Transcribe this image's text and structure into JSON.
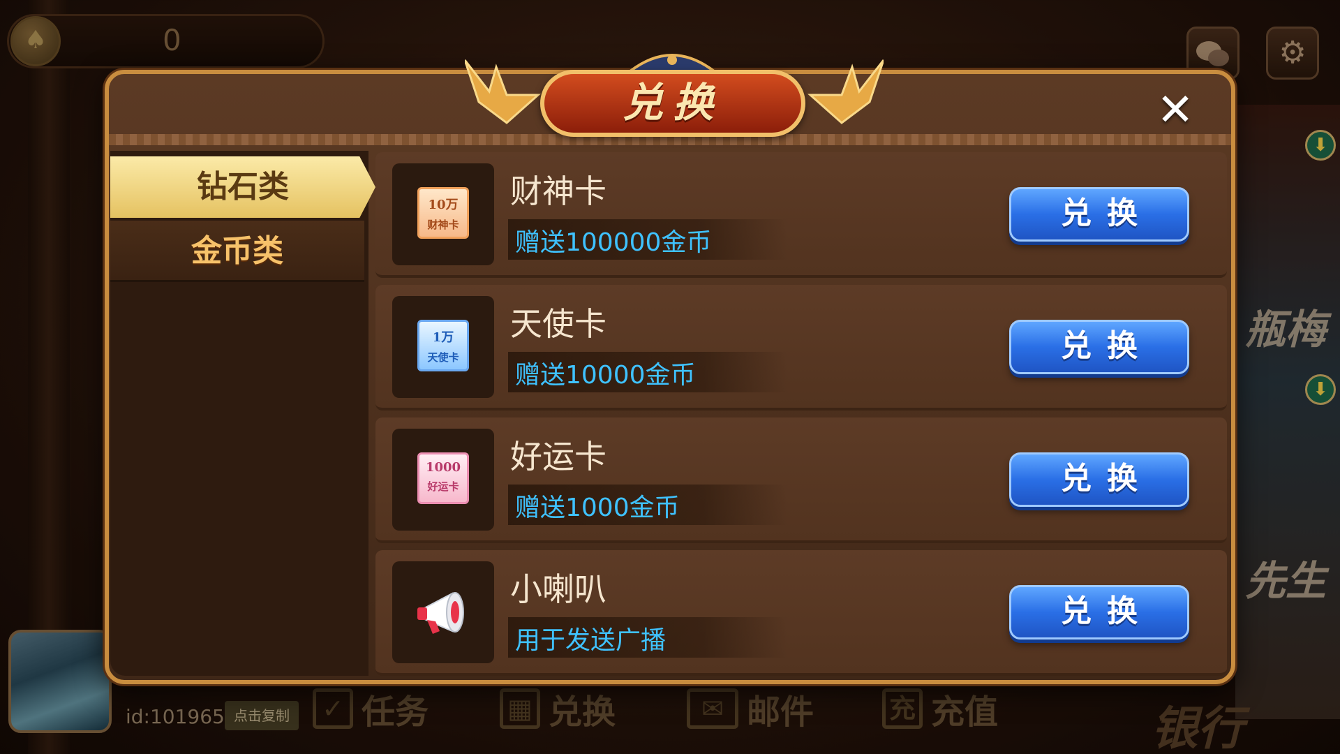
{
  "top_bar": {
    "coin_value": "0",
    "chat_icon": "chat-bubbles-icon",
    "settings_icon": "gear-icon"
  },
  "background": {
    "right_text_1": "瓶梅",
    "right_text_2": "先生"
  },
  "bottom_bar": {
    "user_id": "id:1019654",
    "copy_label": "点击复制",
    "nav": [
      {
        "label": "任务",
        "icon": "task-check-icon"
      },
      {
        "label": "兑换",
        "icon": "exchange-grid-icon"
      },
      {
        "label": "邮件",
        "icon": "mail-icon"
      },
      {
        "label": "充值",
        "icon": "recharge-icon",
        "icon_glyph": "充"
      }
    ],
    "bank_label": "银行"
  },
  "modal": {
    "title": "兑换",
    "close_glyph": "✕",
    "tabs": [
      {
        "label": "钻石类",
        "active": true
      },
      {
        "label": "金币类",
        "active": false
      }
    ],
    "items": [
      {
        "name": "财神卡",
        "desc": "赠送100000金币",
        "button": "兑换",
        "card_amount": "10万",
        "card_label": "财神卡",
        "style": "orange"
      },
      {
        "name": "天使卡",
        "desc": "赠送10000金币",
        "button": "兑换",
        "card_amount": "1万",
        "card_label": "天使卡",
        "style": "blue"
      },
      {
        "name": "好运卡",
        "desc": "赠送1000金币",
        "button": "兑换",
        "card_amount": "1000",
        "card_label": "好运卡",
        "style": "pink"
      },
      {
        "name": "小喇叭",
        "desc": "用于发送广播",
        "button": "兑换",
        "icon": "megaphone-icon"
      }
    ]
  },
  "colors": {
    "accent_gold": "#c98d3f",
    "button_blue": "#2a6fe6",
    "desc_text": "#3fc2ff",
    "tab_active": "#e5c261",
    "tab_inactive_text": "#f7c26a",
    "title_red": "#b8340f"
  }
}
